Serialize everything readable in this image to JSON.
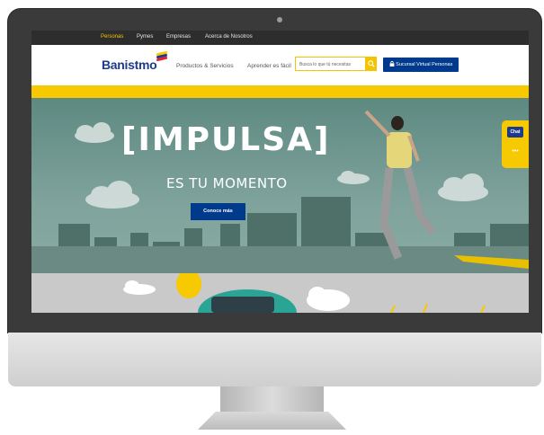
{
  "top_nav": {
    "items": [
      "Personas",
      "Pymes",
      "Empresas",
      "Acerca de Nosotros"
    ],
    "active": "Personas"
  },
  "main_nav": {
    "logo": "Banistmo",
    "links": [
      "Productos & Servicios",
      "Aprender es fácil"
    ],
    "search_placeholder": "Busca lo que tú necesitas",
    "sucursal_button": "Sucursal Virtual Personas"
  },
  "hero": {
    "title": "[IMPULSA]",
    "subtitle": "ES TU MOMENTO",
    "button": "Conoce más"
  },
  "chat_widget": {
    "label": "Chat",
    "dots": "•••"
  },
  "colors": {
    "brand_blue": "#003a8c",
    "brand_yellow": "#f7c900",
    "hero_bg": "#6f9890"
  }
}
